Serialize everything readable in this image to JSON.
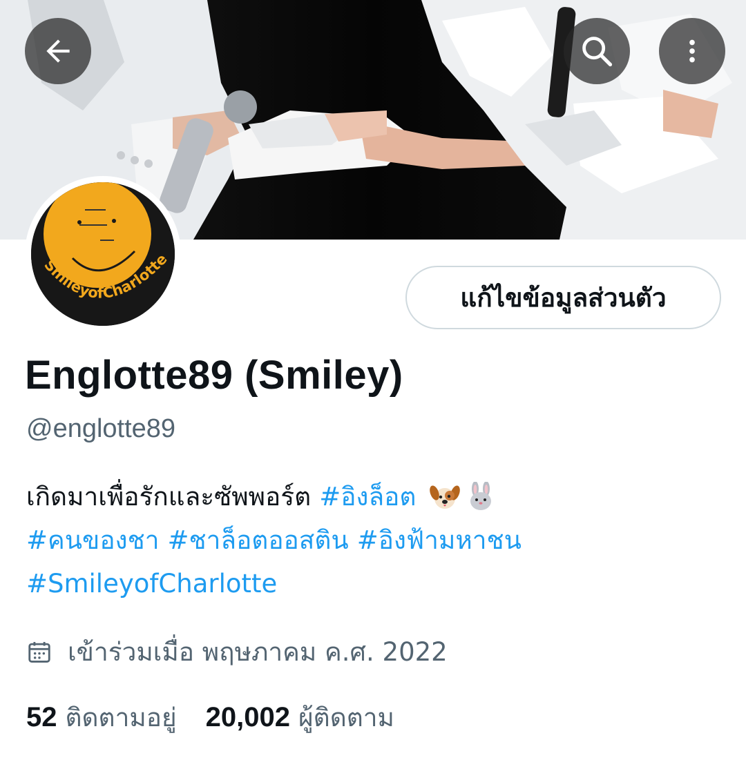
{
  "header": {
    "back_icon": "arrow-left-icon",
    "search_icon": "search-icon",
    "more_icon": "more-vertical-icon"
  },
  "profile": {
    "edit_button_label": "แก้ไขข้อมูลส่วนตัว",
    "display_name": "Englotte89 (Smiley)",
    "handle": "@englotte89",
    "avatar_text": "SmileyofCharlotte",
    "bio": {
      "line1_text": "เกิดมาเพื่อรักและซัพพอร์ต",
      "line1_tag": "#อิงล็อต",
      "line1_emojis": [
        "dog-face-emoji",
        "rabbit-face-emoji"
      ],
      "line2_tags": [
        "#คนของชา",
        "#ชาล็อตออสติน",
        "#อิงฟ้ามหาชน"
      ],
      "line3_tag": "#SmileyofCharlotte"
    },
    "joined": {
      "icon": "calendar-icon",
      "text": "เข้าร่วมเมื่อ พฤษภาคม ค.ศ. 2022"
    },
    "stats": {
      "following_count": "52",
      "following_label": "ติดตามอยู่",
      "followers_count": "20,002",
      "followers_label": "ผู้ติดตาม"
    }
  },
  "colors": {
    "link": "#1d9bf0",
    "secondary_text": "#536471",
    "primary_text": "#0f1419",
    "avatar_face": "#f2a81d"
  }
}
